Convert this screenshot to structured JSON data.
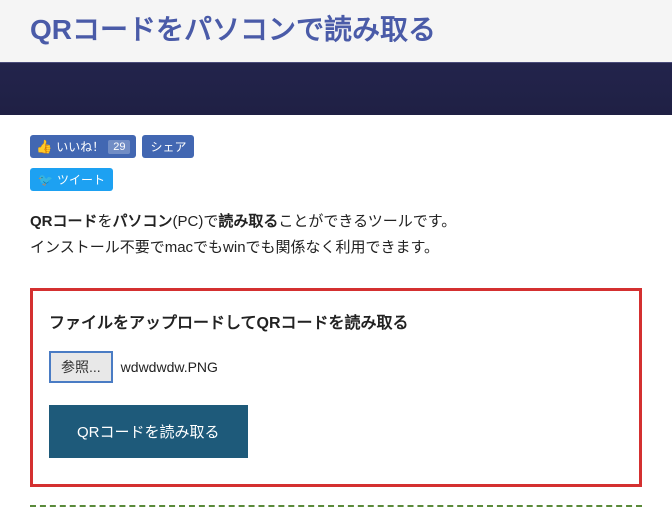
{
  "header": {
    "title": "QRコードをパソコンで読み取る"
  },
  "social": {
    "fb_like_label": "いいね！",
    "fb_like_count": "29",
    "fb_share_label": "シェア",
    "tw_tweet_label": "ツイート"
  },
  "description": {
    "part1_bold": "QRコード",
    "part2": "を",
    "part3_bold": "パソコン",
    "part4": "(PC)で",
    "part5_bold": "読み取る",
    "part6": "ことができるツールです。",
    "line2": "インストール不要でmacでもwinでも関係なく利用できます。"
  },
  "upload": {
    "title": "ファイルをアップロードしてQRコードを読み取る",
    "browse_label": "参照...",
    "filename": "wdwdwdw.PNG",
    "read_button": "QRコードを読み取る"
  }
}
